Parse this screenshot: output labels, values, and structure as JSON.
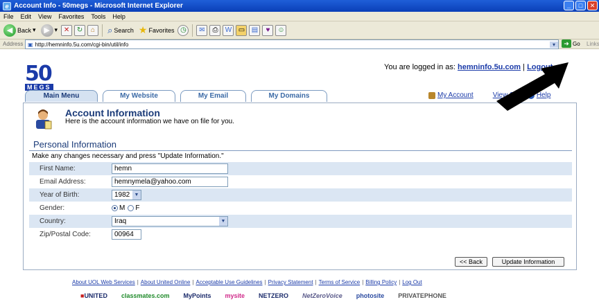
{
  "window": {
    "title": "Account Info - 50megs - Microsoft Internet Explorer"
  },
  "menu": [
    "File",
    "Edit",
    "View",
    "Favorites",
    "Tools",
    "Help"
  ],
  "toolbar": {
    "back": "Back",
    "search": "Search",
    "favorites": "Favorites"
  },
  "address": {
    "label": "Address",
    "url": "http://hemninfo.5u.com/cgi-bin/util/info",
    "go": "Go",
    "links": "Links"
  },
  "logo": {
    "number": "50",
    "word": "MEGS"
  },
  "login": {
    "prefix": "You are logged in as:",
    "user": "hemninfo.5u.com",
    "divider": "|",
    "logout": "Logout"
  },
  "tabs": [
    {
      "label": "Main Menu",
      "active": true
    },
    {
      "label": "My Website",
      "active": false
    },
    {
      "label": "My Email",
      "active": false
    },
    {
      "label": "My Domains",
      "active": false
    }
  ],
  "toplinks": {
    "account": "My Account",
    "view_site": "View Site",
    "help": "Help",
    "divider": "|"
  },
  "header": {
    "title": "Account Information",
    "subtitle": "Here is the account information we have on file for you."
  },
  "section": {
    "title": "Personal Information",
    "instructions": "Make any changes necessary and press \"Update Information.\""
  },
  "form": {
    "first_name_label": "First Name:",
    "first_name_value": "hemn",
    "email_label": "Email Address:",
    "email_value": "hemnymela@yahoo.com",
    "year_label": "Year of Birth:",
    "year_value": "1982",
    "gender_label": "Gender:",
    "gender_m": "M",
    "gender_f": "F",
    "gender_selected": "M",
    "country_label": "Country:",
    "country_value": "Iraq",
    "zip_label": "Zip/Postal Code:",
    "zip_value": "00964"
  },
  "buttons": {
    "back": "<< Back",
    "update": "Update Information"
  },
  "footer": {
    "links": [
      "About UOL Web Services",
      "About United Online",
      "Acceptable Use Guidelines",
      "Privacy Statement",
      "Terms of Service",
      "Billing Policy",
      "Log Out"
    ],
    "divider": "|"
  },
  "brands": [
    "UNITED",
    "classmates.com",
    "MyPoints",
    "mysite",
    "NETZERO",
    "NetZeroVoice",
    "photosite",
    "PRIVATEPHONE"
  ],
  "colors": {
    "titlebar": "#0a3fb8",
    "brand_blue": "#1a3aa8",
    "row_shade": "#dbe6f3"
  }
}
